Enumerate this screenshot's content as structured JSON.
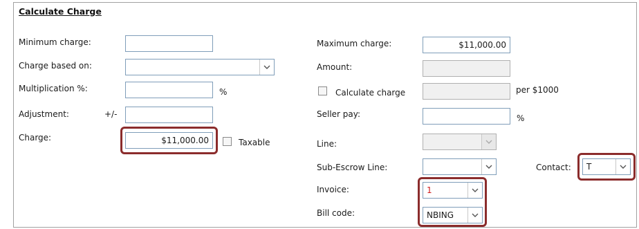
{
  "section": {
    "title": "Calculate Charge"
  },
  "left": {
    "minimum_charge_label": "Minimum charge:",
    "minimum_charge_value": "",
    "charge_based_on_label": "Charge based on:",
    "charge_based_on_value": "",
    "multiplication_label": "Multiplication %:",
    "multiplication_value": "",
    "multiplication_unit": "%",
    "adjustment_label": "Adjustment:",
    "adjustment_sign": "+/-",
    "adjustment_value": "",
    "charge_label": "Charge:",
    "charge_value": "$11,000.00",
    "taxable_label": "Taxable",
    "taxable_checked": false
  },
  "right": {
    "maximum_charge_label": "Maximum charge:",
    "maximum_charge_value": "$11,000.00",
    "amount_label": "Amount:",
    "amount_value": "",
    "calculate_charge_label": "Calculate charge",
    "calculate_charge_checked": false,
    "calculate_charge_value": "",
    "per_label": "per $1000",
    "seller_pay_label": "Seller pay:",
    "seller_pay_value": "",
    "seller_pay_unit": "%",
    "line_label": "Line:",
    "line_value": "",
    "sub_escrow_label": "Sub-Escrow Line:",
    "sub_escrow_value": "",
    "contact_label": "Contact:",
    "contact_value": "T",
    "invoice_label": "Invoice:",
    "invoice_value": "1",
    "bill_code_label": "Bill code:",
    "bill_code_value": "NBING"
  },
  "colors": {
    "highlight": "#8b2c2c",
    "invoice_text": "#d01c1c",
    "field_border": "#7f9db9"
  }
}
